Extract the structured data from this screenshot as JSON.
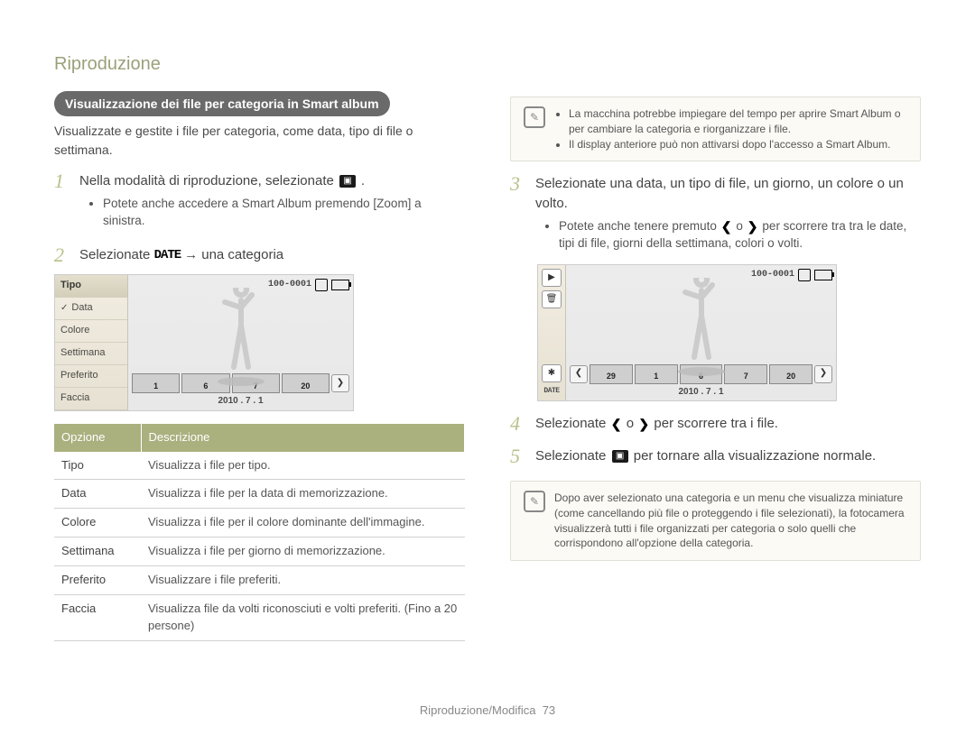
{
  "header": {
    "section": "Riproduzione"
  },
  "pill": "Visualizzazione dei file per categoria in Smart album",
  "intro": "Visualizzate e gestite i file per categoria, come data, tipo di file o settimana.",
  "step1": {
    "text_a": "Nella modalità di riproduzione, selezionate ",
    "text_b": ".",
    "bullet": "Potete anche accedere a Smart Album premendo [Zoom] a sinistra."
  },
  "step2": {
    "text_a": "Selezionate ",
    "text_b": " → una categoria"
  },
  "cam1": {
    "side": [
      "Tipo",
      "Data",
      "Colore",
      "Settimana",
      "Preferito",
      "Faccia"
    ],
    "selected_index": 1,
    "header_index": 0,
    "counter": "100-0001",
    "frames": [
      "1",
      "6",
      "7",
      "20"
    ],
    "date": "2010 . 7 . 1"
  },
  "table": {
    "headers": [
      "Opzione",
      "Descrizione"
    ],
    "rows": [
      [
        "Tipo",
        "Visualizza i file per tipo."
      ],
      [
        "Data",
        "Visualizza i file per la data di memorizzazione."
      ],
      [
        "Colore",
        "Visualizza i file per il colore dominante dell'immagine."
      ],
      [
        "Settimana",
        "Visualizza i file per giorno di memorizzazione."
      ],
      [
        "Preferito",
        "Visualizzare i file preferiti."
      ],
      [
        "Faccia",
        "Visualizza file da volti riconosciuti e volti preferiti. (Fino a 20 persone)"
      ]
    ]
  },
  "info1": [
    "La macchina potrebbe impiegare del tempo per aprire Smart Album o per cambiare la categoria e riorganizzare i file.",
    "Il display anteriore può non attivarsi dopo l'accesso a Smart Album."
  ],
  "step3": {
    "text": "Selezionate una data, un tipo di file, un giorno, un colore o un volto.",
    "bullet_a": "Potete anche tenere premuto ",
    "bullet_mid": " o ",
    "bullet_b": " per scorrere tra tra le date, tipi di file, giorni della settimana, colori o volti."
  },
  "cam2": {
    "counter": "100-0001",
    "frames": [
      "29",
      "1",
      "6",
      "7",
      "20"
    ],
    "date": "2010 . 7 . 1",
    "date_label": "DATE"
  },
  "step4": {
    "text_a": "Selezionate ",
    "text_mid": " o ",
    "text_b": " per scorrere tra i file."
  },
  "step5": {
    "text_a": "Selezionate ",
    "text_b": " per tornare alla visualizzazione normale."
  },
  "info2": "Dopo aver selezionato una categoria e un menu che visualizza miniature (come cancellando più file o proteggendo i file selezionati), la fotocamera visualizzerà tutti i file organizzati per categoria o solo quelli che corrispondono all'opzione della categoria.",
  "footer": {
    "label": "Riproduzione/Modifica",
    "page": "73"
  },
  "icons": {
    "play": "▶",
    "trash": "🗑",
    "flower": "✱",
    "left": "❮",
    "right": "❯",
    "check": "✓"
  }
}
